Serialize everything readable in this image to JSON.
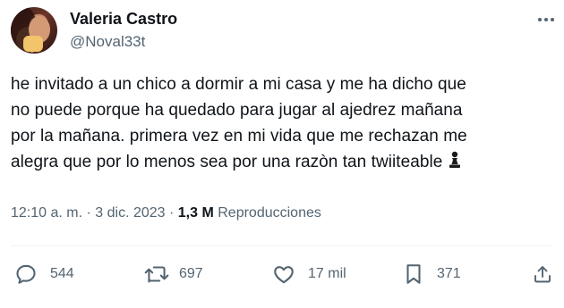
{
  "author": {
    "display_name": "Valeria Castro",
    "handle": "@Noval33t"
  },
  "tweet": {
    "lines": [
      "he invitado a un chico a dormir a mi casa y me ha dicho que",
      "no puede porque ha quedado para jugar al ajedrez mañana",
      "por la mañana. primera vez en mi vida que me rechazan me",
      "alegra que por lo menos sea por una razòn tan twiiteable"
    ],
    "emoji": "chess-pawn"
  },
  "meta": {
    "timestamp": "12:10 a. m. · 3 dic. 2023 ·",
    "views_count": "1,3 M",
    "views_label": "Reproducciones"
  },
  "actions": {
    "replies": "544",
    "retweets": "697",
    "likes": "17 mil",
    "bookmarks": "371"
  },
  "icons": [
    "more-icon",
    "reply-icon",
    "retweet-icon",
    "like-icon",
    "bookmark-icon",
    "share-icon"
  ],
  "colors": {
    "text": "#0f1419",
    "secondary": "#536471",
    "divider": "#eff3f4"
  }
}
